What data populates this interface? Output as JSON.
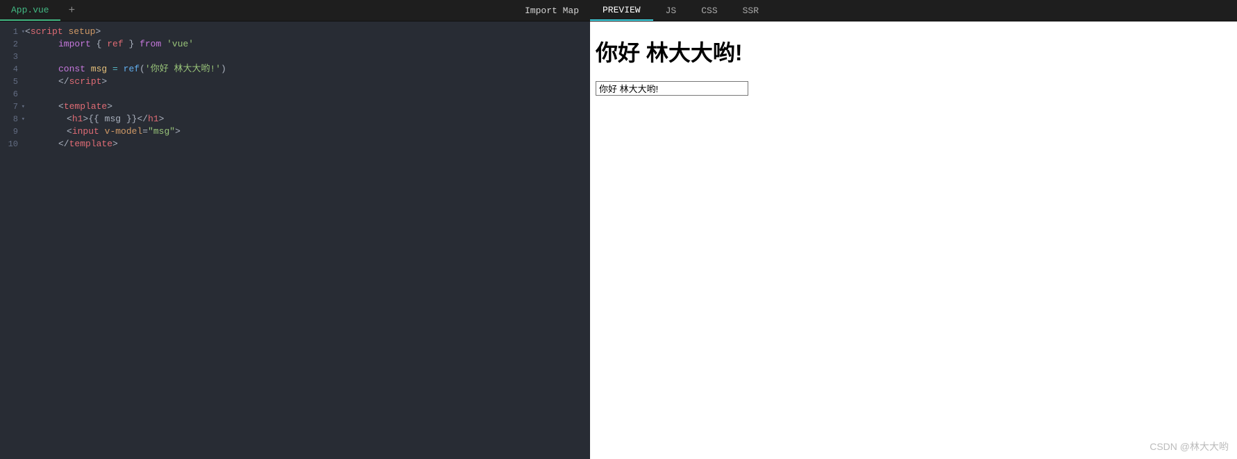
{
  "tabs": {
    "file_tab": "App.vue",
    "add_icon": "+"
  },
  "toolbar": {
    "import_map": "Import Map"
  },
  "editor": {
    "lines": [
      {
        "num": "1",
        "fold": true
      },
      {
        "num": "2"
      },
      {
        "num": "3"
      },
      {
        "num": "4"
      },
      {
        "num": "5"
      },
      {
        "num": "6"
      },
      {
        "num": "7",
        "fold": true
      },
      {
        "num": "8",
        "fold": true
      },
      {
        "num": "9"
      },
      {
        "num": "10"
      }
    ],
    "code": {
      "l1": {
        "open": "<",
        "tag": "script",
        "attr": "setup",
        "close": ">"
      },
      "l2": {
        "kw": "import",
        "brace_o": "{ ",
        "ident": "ref",
        "brace_c": " }",
        "from": "from",
        "str": "'vue'"
      },
      "l4": {
        "const": "const",
        "var": "msg",
        "eq": "=",
        "func": "ref",
        "paren_o": "(",
        "str": "'你好 林大大哟!'",
        "paren_c": ")"
      },
      "l5": {
        "open": "</",
        "tag": "script",
        "close": ">"
      },
      "l7": {
        "open": "<",
        "tag": "template",
        "close": ">"
      },
      "l8": {
        "open1": "<",
        "tag1": "h1",
        "close1": ">",
        "expr": "{{ msg }}",
        "open2": "</",
        "tag2": "h1",
        "close2": ">"
      },
      "l9": {
        "open": "<",
        "tag": "input",
        "attr": "v-model",
        "eq": "=",
        "val": "\"msg\"",
        "close": ">"
      },
      "l10": {
        "open": "</",
        "tag": "template",
        "close": ">"
      }
    }
  },
  "preview_tabs": {
    "preview": "PREVIEW",
    "js": "JS",
    "css": "CSS",
    "ssr": "SSR"
  },
  "preview": {
    "heading": "你好 林大大哟!",
    "input_value": "你好 林大大哟!"
  },
  "watermark": "CSDN @林大大哟"
}
